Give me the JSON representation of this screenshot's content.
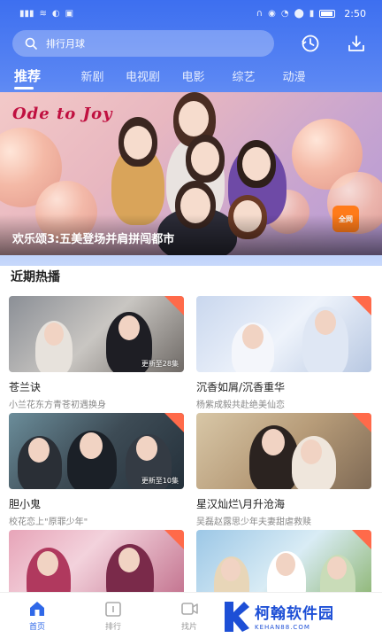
{
  "status_bar": {
    "time": "2:50"
  },
  "search": {
    "placeholder": "排行月球"
  },
  "tabs": [
    {
      "label": "推荐",
      "active": true
    },
    {
      "label": "新剧"
    },
    {
      "label": "电视剧"
    },
    {
      "label": "电影"
    },
    {
      "label": "综艺"
    },
    {
      "label": "动漫"
    }
  ],
  "banner": {
    "logo_text": "Ode to Joy",
    "badge_text": "全网",
    "caption": "欢乐颂3:五美登场并肩拼闯都市"
  },
  "section": {
    "title": "近期热播"
  },
  "cards": [
    {
      "title": "苍兰诀",
      "subtitle": "小兰花东方青苍初遇换身",
      "episode": "更新至28集"
    },
    {
      "title": "沉香如屑/沉香重华",
      "subtitle": "杨紫成毅共赴绝美仙恋",
      "episode": ""
    },
    {
      "title": "胆小鬼",
      "subtitle": "校花恋上\"原罪少年\"",
      "episode": "更新至10集"
    },
    {
      "title": "星汉灿烂\\月升沧海",
      "subtitle": "吴磊赵露思少年夫妻甜虐救赎",
      "episode": ""
    },
    {
      "title": "",
      "subtitle": "",
      "episode": ""
    },
    {
      "title": "",
      "subtitle": "",
      "episode": ""
    }
  ],
  "bottom_nav": [
    {
      "label": "首页",
      "active": true,
      "icon": "home-icon"
    },
    {
      "label": "排行",
      "icon": "ranking-icon"
    },
    {
      "label": "找片",
      "icon": "film-icon"
    }
  ],
  "watermark": {
    "main": "柯翰软件园",
    "sub": "KEHAN88.COM"
  },
  "colors": {
    "primary": "#2f68e8",
    "header_top": "#3d6ff0",
    "corner": "#ff6a4a"
  }
}
